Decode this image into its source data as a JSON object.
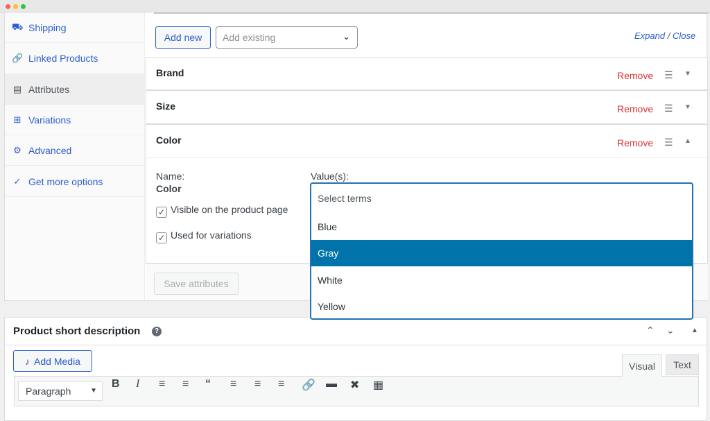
{
  "sidebar": {
    "items": [
      {
        "label": "Shipping",
        "icon": "truck-icon"
      },
      {
        "label": "Linked Products",
        "icon": "link-icon"
      },
      {
        "label": "Attributes",
        "icon": "list-icon",
        "active": true
      },
      {
        "label": "Variations",
        "icon": "grid-icon"
      },
      {
        "label": "Advanced",
        "icon": "gear-icon"
      },
      {
        "label": "Get more options",
        "icon": "plugin-icon"
      }
    ]
  },
  "toolbar": {
    "add_new": "Add new",
    "add_existing": "Add existing",
    "expand": "Expand",
    "sep": " / ",
    "close": "Close"
  },
  "attributes": [
    {
      "name": "Brand",
      "remove": "Remove"
    },
    {
      "name": "Size",
      "remove": "Remove"
    },
    {
      "name": "Color",
      "remove": "Remove"
    }
  ],
  "color_detail": {
    "name_label": "Name:",
    "name_value": "Color",
    "values_label": "Value(s):",
    "visible": "Visible on the product page",
    "variations": "Used for variations"
  },
  "dropdown": {
    "placeholder": "Select terms",
    "options": [
      "Blue",
      "Gray",
      "White",
      "Yellow"
    ],
    "highlighted": "Gray"
  },
  "save_attributes": "Save attributes",
  "short_desc": {
    "title": "Product short description",
    "add_media": "Add Media",
    "tab_visual": "Visual",
    "tab_text": "Text",
    "format": "Paragraph"
  },
  "colors": {
    "accent": "#2c5dcd",
    "remove": "#d63638",
    "highlight": "#0073aa"
  }
}
